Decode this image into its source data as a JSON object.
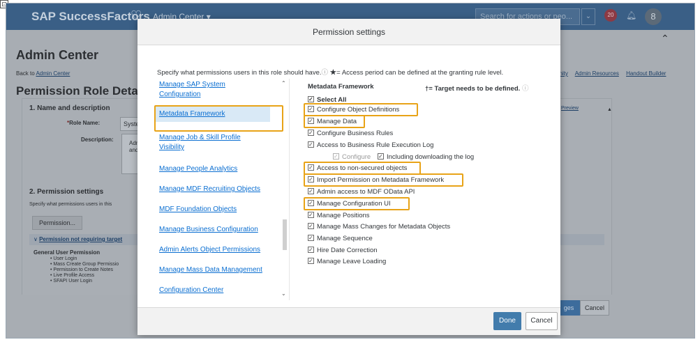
{
  "shell": {
    "brand": "SAP SuccessFactors",
    "admin_menu": "Admin Center ▾",
    "search_placeholder": "Search for actions or peo...",
    "notification_count": "20"
  },
  "page": {
    "title": "Admin Center",
    "back_prefix": "Back to",
    "back_link": "Admin Center",
    "top_links": [
      "unity",
      "Admin Resources",
      "Handout Builder"
    ],
    "role_title": "Permission Role Deta",
    "section1": "1. Name and description",
    "role_name_label": "Role Name:",
    "role_name_value": "Syste",
    "description_label": "Description:",
    "description_value": "Adm\nand l",
    "preview_link": "Preview",
    "section2": "2. Permission settings",
    "spec_text": "Specify what permissions users in this",
    "permission_button": "Permission...",
    "perm_row": "Permission not requiring target",
    "general_title": "General User Permission",
    "general_items": [
      "User Login",
      "Mass Create Group Permissio",
      "Permission to Create Notes",
      "Live Profile Access",
      "SFAPI User Login"
    ],
    "save_partial": "ges",
    "cancel": "Cancel"
  },
  "dialog": {
    "title": "Permission settings",
    "intro": "Specify what permissions users in this role should have.",
    "intro_note": "★= Access period can be defined at the granting rule level.",
    "nav_items": [
      "Manage SAP System Configuration",
      "Metadata Framework",
      "Manage Job & Skill Profile Visibility",
      "Manage People Analytics",
      "Manage MDF Recruiting Objects",
      "MDF Foundation Objects",
      "Manage Business Configuration",
      "Admin Alerts Object Permissions",
      "Manage Mass Data Management",
      "Configuration Center"
    ],
    "section_title": "Metadata Framework",
    "target_note": "†= Target needs to be defined.",
    "select_all": "Select All",
    "permissions": [
      "Configure Object Definitions",
      "Manage Data",
      "Configure Business Rules",
      "Access to Business Rule Execution Log",
      "Configure",
      "Including downloading the log",
      "Access to non-secured objects",
      "Import Permission on Metadata Framework",
      "Admin access to MDF OData API",
      "Manage Configuration UI",
      "Manage Positions",
      "Manage Mass Changes for Metadata Objects",
      "Manage Sequence",
      "Hire Date Correction",
      "Manage Leave Loading"
    ],
    "done": "Done",
    "cancel": "Cancel"
  },
  "colors": {
    "highlight": "#e8a317",
    "link": "#0a6ed1",
    "done_button": "#427cac",
    "shell": "#3a5f86"
  }
}
